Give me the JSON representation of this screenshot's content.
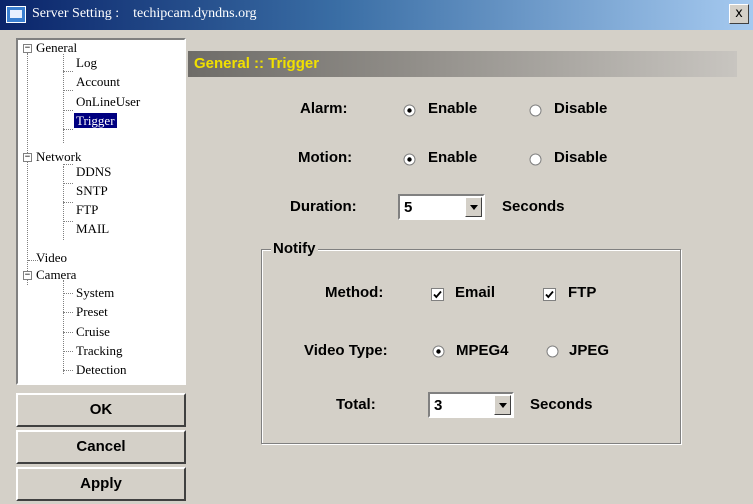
{
  "window": {
    "title": "Server Setting :    techipcam.dyndns.org",
    "close_label": "x"
  },
  "tree": {
    "general": "General",
    "log": "Log",
    "account": "Account",
    "online_user": "OnLineUser",
    "trigger": "Trigger",
    "network": "Network",
    "ddns": "DDNS",
    "sntp": "SNTP",
    "ftp": "FTP",
    "mail": "MAIL",
    "video": "Video",
    "camera": "Camera",
    "system": "System",
    "preset": "Preset",
    "cruise": "Cruise",
    "tracking": "Tracking",
    "detection": "Detection",
    "expanded_glyph": "−"
  },
  "buttons": {
    "ok": "OK",
    "cancel": "Cancel",
    "apply": "Apply"
  },
  "panel": {
    "title": "General :: Trigger",
    "alarm": {
      "label": "Alarm:",
      "enable": "Enable",
      "disable": "Disable",
      "selected": "Enable"
    },
    "motion": {
      "label": "Motion:",
      "enable": "Enable",
      "disable": "Disable",
      "selected": "Enable"
    },
    "duration": {
      "label": "Duration:",
      "value": "5",
      "unit": "Seconds"
    },
    "notify": {
      "legend": "Notify",
      "method": {
        "label": "Method:",
        "email": "Email",
        "ftp": "FTP",
        "email_checked": true,
        "ftp_checked": true
      },
      "video_type": {
        "label": "Video Type:",
        "mpeg4": "MPEG4",
        "jpeg": "JPEG",
        "selected": "MPEG4"
      },
      "total": {
        "label": "Total:",
        "value": "3",
        "unit": "Seconds"
      }
    }
  },
  "colors": {
    "title_bar_start": "#0a246a",
    "title_bar_end": "#a6caf0",
    "panel_title_text": "#f0e000",
    "selection": "#000080",
    "face": "#d4d0c8"
  }
}
